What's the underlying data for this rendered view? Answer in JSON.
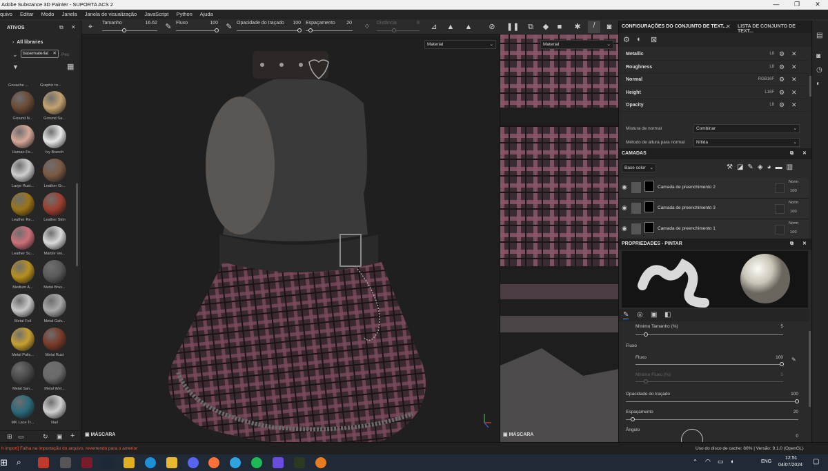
{
  "window": {
    "title": "Adobe Substance 3D Painter - SUPORTA ACS 2",
    "minimize": "—",
    "maximize": "❐",
    "close": "✕"
  },
  "menu": [
    "quivo",
    "Editar",
    "Modo",
    "Janela",
    "Janela de visualização",
    "JavaScript",
    "Python",
    "Ajuda"
  ],
  "toolbar": {
    "size_label": "Tamanho",
    "size_value": "16.62",
    "flow_label": "Fluxo",
    "flow_value": "100",
    "opacity_label": "Opacidade do traçado",
    "opacity_value": "100",
    "spacing_label": "Espaçamento",
    "spacing_value": "20",
    "distance_label": "Distância",
    "distance_value": "8"
  },
  "assets": {
    "title": "ATIVOS",
    "all_libraries": "All libraries",
    "filter_value": "basematerial",
    "search_placeholder": "Pes",
    "top_labels": [
      "Gouache ...",
      "Graphic to..."
    ],
    "materials": [
      {
        "label": "Ground N...",
        "color": "#6b4a33"
      },
      {
        "label": "Ground Sa...",
        "color": "#c4a270"
      },
      {
        "label": "Human Fe...",
        "color": "#d7a897"
      },
      {
        "label": "Ivy Branch",
        "color": "#e8e8e8"
      },
      {
        "label": "Large Rust...",
        "color": "#cfcfcf"
      },
      {
        "label": "Leather Gr...",
        "color": "#7a5a42"
      },
      {
        "label": "Leather Re...",
        "color": "#9a7418"
      },
      {
        "label": "Leather Skin",
        "color": "#9c4030"
      },
      {
        "label": "Leather Su...",
        "color": "#cc7078"
      },
      {
        "label": "Marble Vei...",
        "color": "#dadada"
      },
      {
        "label": "Medium A...",
        "color": "#b8901e"
      },
      {
        "label": "Metal Brus...",
        "color": "#5a5a5a"
      },
      {
        "label": "Metal Foil",
        "color": "#c8c8c8"
      },
      {
        "label": "Metal Galv...",
        "color": "#a8a8a8"
      },
      {
        "label": "Metal Polis...",
        "color": "#c8a030"
      },
      {
        "label": "Metal Rust",
        "color": "#7a3a28"
      },
      {
        "label": "Metal San...",
        "color": "#4a4a4a"
      },
      {
        "label": "Metal Wel...",
        "color": "#6a6a6a"
      },
      {
        "label": "MK Lace Tr...",
        "color": "#2a6a7a"
      },
      {
        "label": "Nail",
        "color": "#d0d0d0"
      }
    ]
  },
  "viewport": {
    "dropdown": "Material",
    "mask_label": "MÁSCARA"
  },
  "uv_view": {
    "dropdown": "Material",
    "mask_label": "MÁSCARA"
  },
  "texture_set": {
    "tab1": "CONFIGURAÇÕES DO CONJUNTO DE TEXT...",
    "tab2": "LISTA DE CONJUNTO DE TEXT...",
    "channels": [
      {
        "name": "Metallic",
        "format": "L8"
      },
      {
        "name": "Roughness",
        "format": "L8"
      },
      {
        "name": "Normal",
        "format": "RGB16F"
      },
      {
        "name": "Height",
        "format": "L16F"
      },
      {
        "name": "Opacity",
        "format": "L8"
      }
    ],
    "normal_mix_label": "Mistura de normal",
    "normal_mix_value": "Combinar",
    "height_method_label": "Método de altura para normal",
    "height_method_value": "Nítida"
  },
  "layers": {
    "title": "CAMADAS",
    "channel_select": "Base color",
    "items": [
      {
        "name": "Camada de preenchimento 2",
        "blend": "Norm",
        "opacity": "100"
      },
      {
        "name": "Camada de preenchimento 3",
        "blend": "Norm",
        "opacity": "100"
      },
      {
        "name": "Camada de preenchimento 1",
        "blend": "Norm",
        "opacity": "100"
      }
    ]
  },
  "properties": {
    "title": "PROPRIEDADES - PINTAR",
    "min_size_label": "Mínimo Tamanho (%)",
    "min_size_value": "5",
    "flow_section": "Fluxo",
    "flow_label": "Fluxo",
    "flow_value": "100",
    "min_flow_label": "Mínimo Fluxo (%)",
    "min_flow_value": "5",
    "stroke_opacity_label": "Opacidade do traçado",
    "stroke_opacity_value": "100",
    "spacing_label": "Espaçamento",
    "spacing_value": "20",
    "angle_label": "Ângulo",
    "angle_value": "0"
  },
  "status": {
    "error": "h import] Falha na importação do arquivo, revertendo para o anterior",
    "cache": "Uso do disco de cache:  80% | Versão: 9.1.0 (OpenGL)"
  },
  "taskbar": {
    "lang": "ENG",
    "time": "12:51",
    "date": "04/07/2024"
  }
}
